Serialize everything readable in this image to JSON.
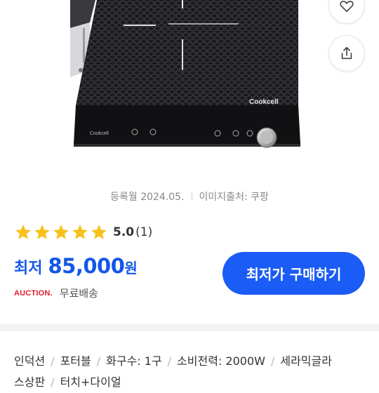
{
  "product": {
    "brand": "Cookcell",
    "controls": [
      "",
      "",
      "",
      ""
    ]
  },
  "meta": {
    "registered": "등록월 2024.05.",
    "image_source": "이미지출처: 쿠팡"
  },
  "rating": {
    "stars": 5,
    "score": "5.0",
    "count": "(1)",
    "star_color": "#f8c21b"
  },
  "price": {
    "label": "최저",
    "value": "85,000",
    "unit": "원",
    "color": "#1457e8"
  },
  "buy_button": {
    "label": "최저가 구매하기",
    "color": "#1a5cf5"
  },
  "shop": {
    "name": "AUCTION.",
    "shipping": "무료배송"
  },
  "specs": {
    "line1": [
      "인덕션",
      "포터블",
      "화구수: 1구",
      "소비전력: 2000W",
      "세라믹글라"
    ],
    "line2": [
      "스상판",
      "터치+다이얼"
    ]
  },
  "icons": {
    "top": "heart-icon",
    "share": "share-icon"
  }
}
